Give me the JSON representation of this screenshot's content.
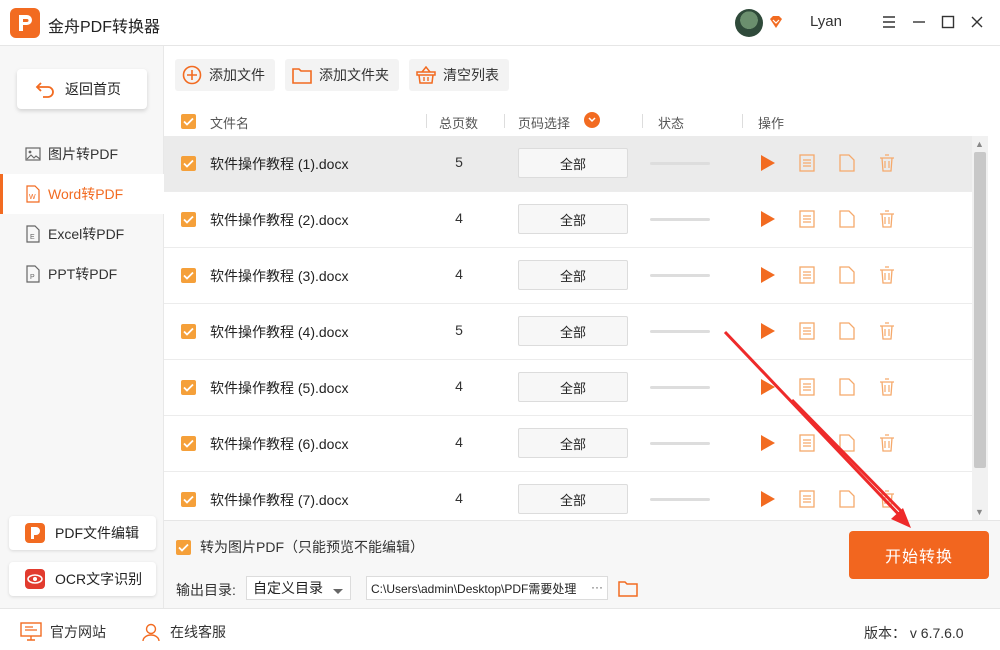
{
  "app": {
    "title": "金舟PDF转换器",
    "username": "Lyan"
  },
  "icons": {
    "logo": "app-logo-icon",
    "vip": "vip-diamond-icon",
    "menu": "menu-icon",
    "minimize": "minimize-icon",
    "maximize": "maximize-icon",
    "close": "close-icon"
  },
  "sidebar": {
    "home_label": "返回首页",
    "items": [
      {
        "label": "图片转PDF",
        "icon": "image-icon",
        "active": false
      },
      {
        "label": "Word转PDF",
        "icon": "word-file-icon",
        "active": true
      },
      {
        "label": "Excel转PDF",
        "icon": "excel-file-icon",
        "active": false
      },
      {
        "label": "PPT转PDF",
        "icon": "ppt-file-icon",
        "active": false
      }
    ],
    "cards": [
      {
        "label": "PDF文件编辑",
        "icon": "pdf-edit-icon"
      },
      {
        "label": "OCR文字识别",
        "icon": "ocr-eye-icon"
      }
    ]
  },
  "toolbar": {
    "add_file": "添加文件",
    "add_folder": "添加文件夹",
    "clear_list": "清空列表"
  },
  "table": {
    "headers": {
      "filename": "文件名",
      "pages": "总页数",
      "range": "页码选择",
      "status": "状态",
      "actions": "操作"
    },
    "rows": [
      {
        "filename": "软件操作教程 (1).docx",
        "pages": "5",
        "range": "全部",
        "progress": 0
      },
      {
        "filename": "软件操作教程 (2).docx",
        "pages": "4",
        "range": "全部",
        "progress": 0
      },
      {
        "filename": "软件操作教程 (3).docx",
        "pages": "4",
        "range": "全部",
        "progress": 0
      },
      {
        "filename": "软件操作教程 (4).docx",
        "pages": "5",
        "range": "全部",
        "progress": 0
      },
      {
        "filename": "软件操作教程 (5).docx",
        "pages": "4",
        "range": "全部",
        "progress": 0
      },
      {
        "filename": "软件操作教程 (6).docx",
        "pages": "4",
        "range": "全部",
        "progress": 0
      },
      {
        "filename": "软件操作教程 (7).docx",
        "pages": "4",
        "range": "全部",
        "progress": 0
      }
    ]
  },
  "options": {
    "image_pdf_label": "转为图片PDF（只能预览不能编辑）",
    "output_label": "输出目录:",
    "output_select": "自定义目录",
    "output_path": "C:\\Users\\admin\\Desktop\\PDF需要处理",
    "path_more": "···",
    "start_button": "开始转换"
  },
  "status": {
    "website": "官方网站",
    "support": "在线客服",
    "version": "版本： v 6.7.6.0"
  },
  "colors": {
    "accent": "#f26b21",
    "checkbox": "#f5a03a",
    "annotation": "#ee2a2a"
  }
}
